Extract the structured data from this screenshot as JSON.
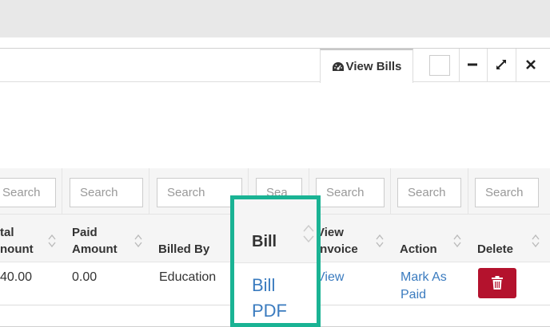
{
  "window": {
    "tab_label": "View Bills",
    "tab_icon": "dashboard-icon",
    "controls": [
      "minimize-icon",
      "expand-icon",
      "close-icon"
    ]
  },
  "filters": {
    "placeholders": [
      "Search",
      "Search",
      "Search",
      "Sea",
      "Search",
      "Search",
      "Search"
    ]
  },
  "table": {
    "headers": {
      "total_amount_l1": "tal",
      "total_amount_l2": "nount",
      "paid_amount_l1": "Paid",
      "paid_amount_l2": "Amount",
      "billed_by": "Billed By",
      "bill": "Bill",
      "view_invoice_l1": "View",
      "view_invoice_l2": "Invoice",
      "action": "Action",
      "delete": "Delete"
    },
    "rows": [
      {
        "total_amount": "40.00",
        "paid_amount": "0.00",
        "billed_by": "Education",
        "bill_link": "Bill PDF",
        "view_invoice": "View",
        "action_link": "Mark As Paid",
        "delete_icon": "trash-icon"
      }
    ]
  },
  "colors": {
    "highlight": "#1ab394",
    "link": "#3a7bbf",
    "delete": "#b4122d"
  }
}
